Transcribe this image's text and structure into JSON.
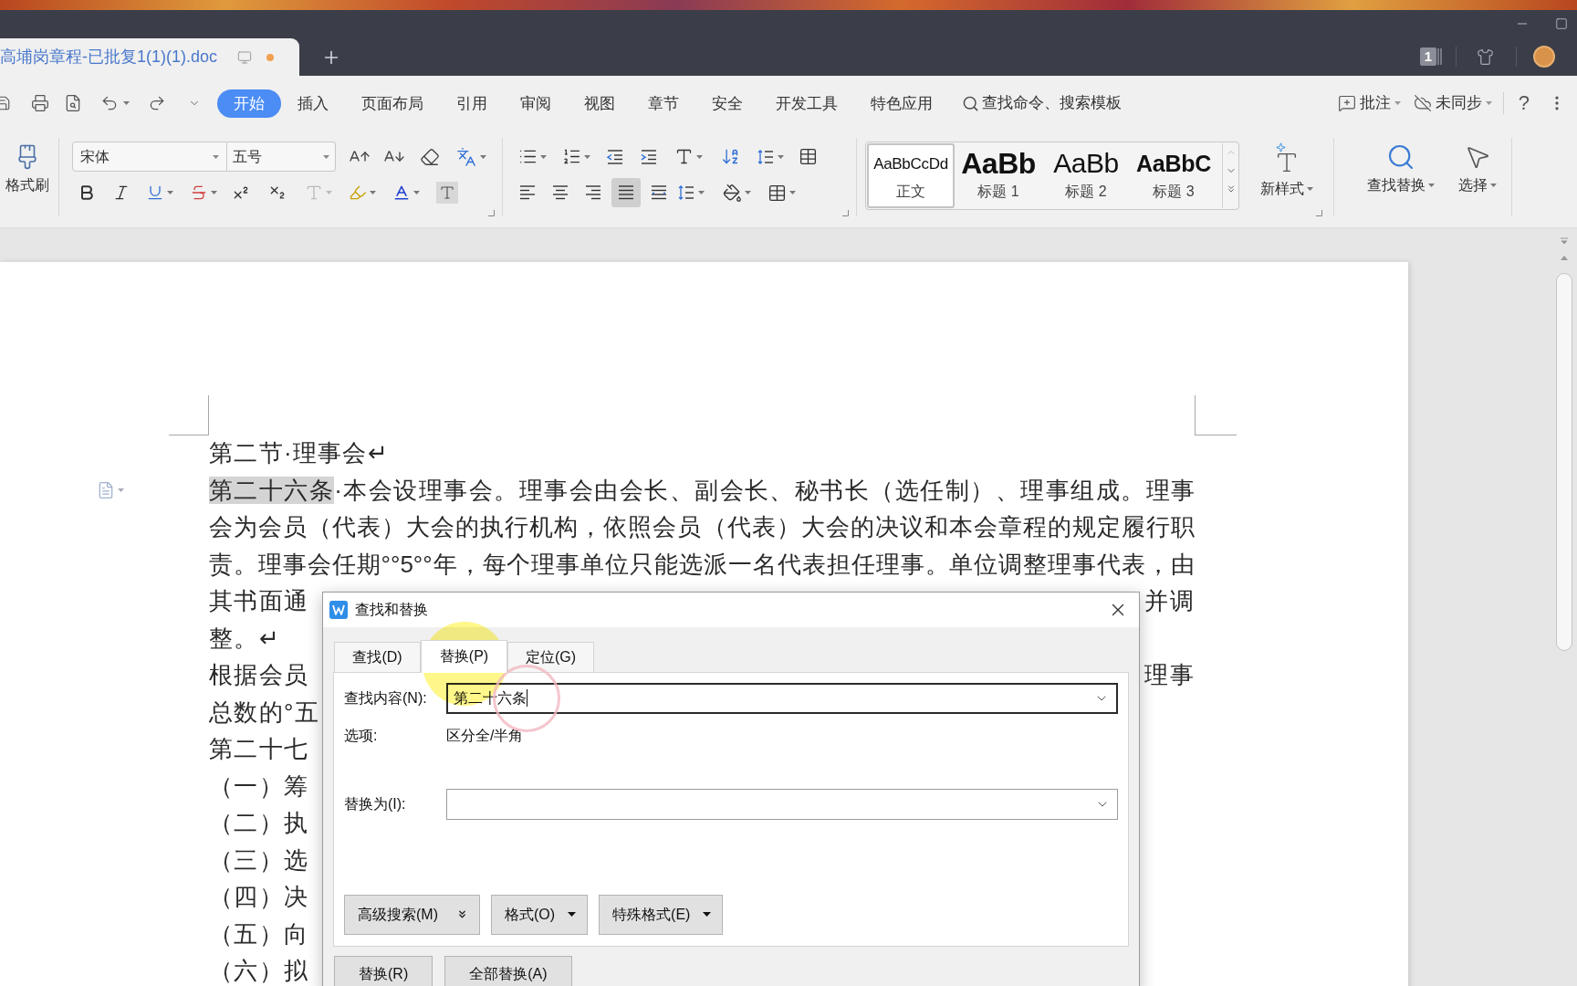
{
  "window": {
    "tab": {
      "title": "高埔岗章程-已批复1(1)(1).doc",
      "unsaved": true
    },
    "tab_count": "1"
  },
  "menu": {
    "tabs": [
      {
        "label": "开始",
        "selected": true
      },
      {
        "label": "插入",
        "selected": false
      },
      {
        "label": "页面布局",
        "selected": false
      },
      {
        "label": "引用",
        "selected": false
      },
      {
        "label": "审阅",
        "selected": false
      },
      {
        "label": "视图",
        "selected": false
      },
      {
        "label": "章节",
        "selected": false
      },
      {
        "label": "安全",
        "selected": false
      },
      {
        "label": "开发工具",
        "selected": false
      },
      {
        "label": "特色应用",
        "selected": false
      }
    ],
    "command_search": "查找命令、搜索模板",
    "actions": [
      {
        "label": "批注",
        "kind": "comment"
      },
      {
        "label": "未同步",
        "kind": "sync"
      }
    ],
    "help": "?"
  },
  "ribbon": {
    "format_painter": "格式刷",
    "font_name": "宋体",
    "font_size": "五号",
    "alignment": [
      {
        "kind": "left",
        "selected": false
      },
      {
        "kind": "center",
        "selected": false
      },
      {
        "kind": "right",
        "selected": false
      },
      {
        "kind": "justify",
        "selected": true
      },
      {
        "kind": "distributed",
        "selected": false
      }
    ],
    "styles": [
      {
        "kind": "body",
        "preview": "AaBbCcDd",
        "label": "正文",
        "selected": true
      },
      {
        "kind": "heading1",
        "preview": "AaBb",
        "label": "标题 1",
        "selected": false
      },
      {
        "kind": "heading2",
        "preview": "AaBb",
        "label": "标题 2",
        "selected": false
      },
      {
        "kind": "heading3",
        "preview": "AaBbC",
        "label": "标题 3",
        "selected": false
      }
    ],
    "new_style": "新样式",
    "find_replace": "查找替换",
    "select": "选择"
  },
  "document": {
    "lines": [
      {
        "kind": "left",
        "text": "第二节·理事会↵"
      },
      {
        "kind": "highlighted",
        "highlight": "第二十六条",
        "text": "·本会设理事会。理事会由会长、副会长、秘书长（选任制）、理事组成。理事"
      },
      {
        "kind": "justified",
        "text": "会为会员（代表）大会的执行机构，依照会员（代表）大会的决议和本会章程的规定履行职"
      },
      {
        "kind": "justified",
        "text": "责。理事会任期°°5°°年，每个理事单位只能选派一名代表担任理事。单位调整理事代表，由"
      },
      {
        "kind": "split",
        "left": "其书面通",
        "right": "并调"
      },
      {
        "kind": "left",
        "text": "整。↵"
      },
      {
        "kind": "split",
        "left": "根据会员",
        "right": "理事"
      },
      {
        "kind": "left",
        "text": "总数的°五"
      },
      {
        "kind": "left",
        "text": "第二十七"
      },
      {
        "kind": "left",
        "text": "（一）筹"
      },
      {
        "kind": "left",
        "text": "（二）执"
      },
      {
        "kind": "left",
        "text": "（三）选"
      },
      {
        "kind": "left",
        "text": "（四）决"
      },
      {
        "kind": "left",
        "text": "（五）向"
      },
      {
        "kind": "left",
        "text": "（六）拟"
      }
    ]
  },
  "dialog": {
    "title": "查找和替换",
    "tabs": [
      {
        "label": "查找(D)",
        "selected": false
      },
      {
        "label": "替换(P)",
        "selected": true
      },
      {
        "label": "定位(G)",
        "selected": false
      }
    ],
    "find": {
      "label": "查找内容(N):",
      "value": "第二十六条"
    },
    "options": {
      "label": "选项:",
      "value": "区分全/半角"
    },
    "replace": {
      "label": "替换为(I):"
    },
    "option_buttons": [
      {
        "kind": "expand",
        "label": "高级搜索(M)"
      },
      {
        "kind": "menu",
        "label": "格式(O)"
      },
      {
        "kind": "menu",
        "label": "特殊格式(E)"
      }
    ],
    "action_buttons": [
      {
        "label": "替换(R)"
      },
      {
        "label": "全部替换(A)"
      }
    ]
  }
}
